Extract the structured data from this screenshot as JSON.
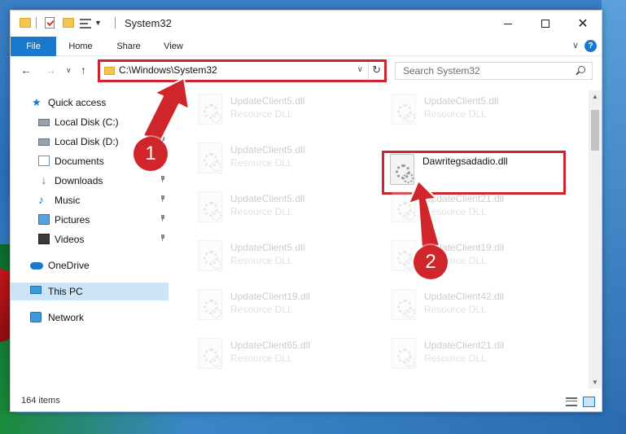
{
  "window": {
    "title": "System32",
    "minimize_label": "",
    "maximize_label": "",
    "close_label": "✕"
  },
  "ribbon": {
    "tabs": [
      "File",
      "Home",
      "Share",
      "View"
    ],
    "expand_glyph": "∨",
    "help_glyph": "?"
  },
  "address": {
    "path": "C:\\Windows\\System32",
    "search_placeholder": "Search System32"
  },
  "sidebar": {
    "items": [
      {
        "label": "Quick access",
        "icon": "star-icon",
        "pinned": false
      },
      {
        "label": "Local Disk (C:)",
        "icon": "disk-icon",
        "pinned": true
      },
      {
        "label": "Local Disk (D:)",
        "icon": "disk-icon",
        "pinned": true
      },
      {
        "label": "Documents",
        "icon": "document-icon",
        "pinned": true
      },
      {
        "label": "Downloads",
        "icon": "download-icon",
        "pinned": true
      },
      {
        "label": "Music",
        "icon": "music-icon",
        "pinned": true
      },
      {
        "label": "Pictures",
        "icon": "pictures-icon",
        "pinned": true
      },
      {
        "label": "Videos",
        "icon": "video-icon",
        "pinned": true
      },
      {
        "label": "OneDrive",
        "icon": "cloud-icon",
        "pinned": false
      },
      {
        "label": "This PC",
        "icon": "computer-icon",
        "pinned": false,
        "selected": true
      },
      {
        "label": "Network",
        "icon": "network-icon",
        "pinned": false
      }
    ]
  },
  "files": {
    "left": [
      {
        "name": "UpdateClient5.dll",
        "type": "Resource DLL"
      },
      {
        "name": "UpdateClient5.dll",
        "type": "Resource DLL"
      },
      {
        "name": "UpdateClient5.dll",
        "type": "Resource DLL"
      },
      {
        "name": "UpdateClient5.dll",
        "type": "Resource DLL"
      },
      {
        "name": "UpdateClient19.dll",
        "type": "Resource DLL"
      },
      {
        "name": "UpdateClient65.dll",
        "type": "Resource DLL"
      }
    ],
    "right": [
      {
        "name": "UpdateClient5.dll",
        "type": "Resource DLL"
      },
      {
        "name": "Dawritegsadadio.dll",
        "type": "",
        "highlighted": true
      },
      {
        "name": "UpdateClient21.dll",
        "type": "Resource DLL"
      },
      {
        "name": "UpdateClient19.dll",
        "type": "Resource DLL"
      },
      {
        "name": "UpdateClient42.dll",
        "type": "Resource DLL"
      },
      {
        "name": "UpdateClient21.dll",
        "type": "Resource DLL"
      }
    ]
  },
  "status": {
    "item_count": "164 items"
  },
  "annotations": {
    "step1": "1",
    "step2": "2",
    "highlight_color": "#d0262b"
  }
}
